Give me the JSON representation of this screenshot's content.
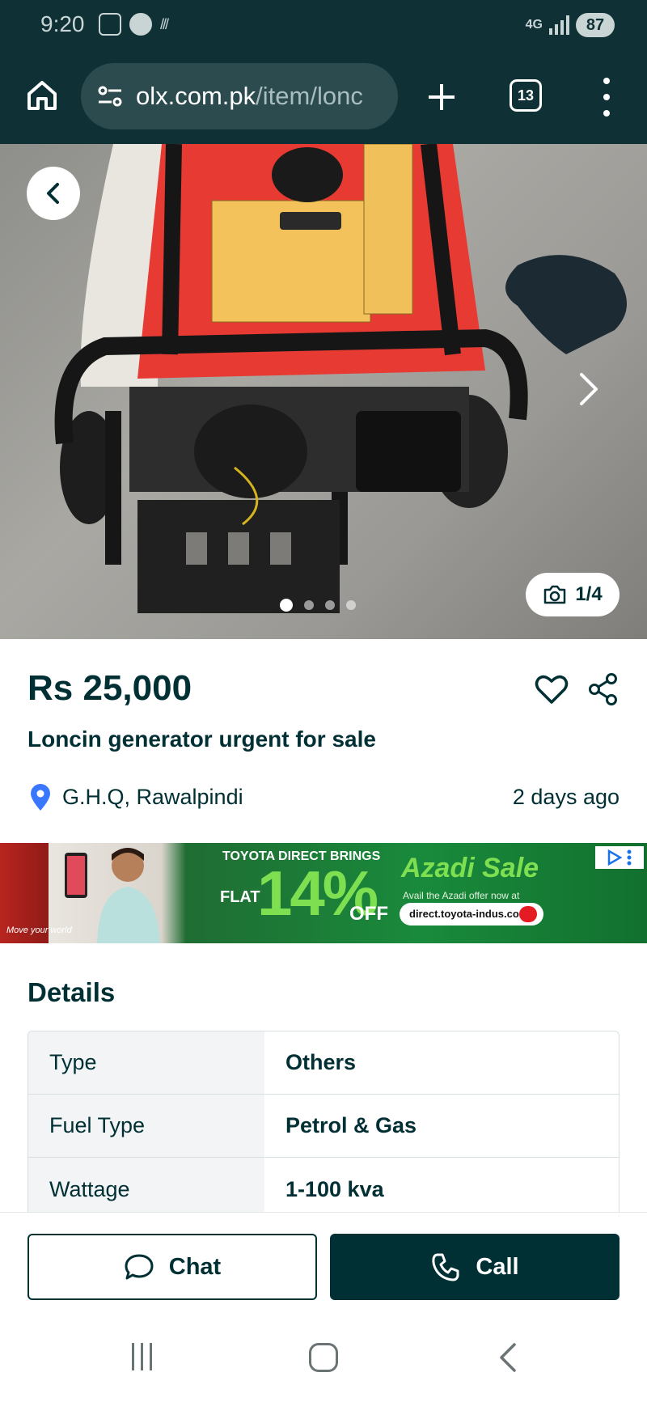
{
  "status_bar": {
    "time": "9:20",
    "network": "4G",
    "battery": "87"
  },
  "browser": {
    "url_domain": "olx.com.pk",
    "url_path": "/item/lonc",
    "tab_count": "13"
  },
  "gallery": {
    "counter": "1/4",
    "dot_count": 4,
    "active_index": 0
  },
  "listing": {
    "price": "Rs 25,000",
    "title": "Loncin generator urgent for sale",
    "location": "G.H.Q, Rawalpindi",
    "posted": "2 days ago"
  },
  "ad": {
    "headline": "TOYOTA DIRECT BRINGS",
    "flat": "FLAT",
    "percent": "14%",
    "off": "OFF",
    "sale_title": "Azadi Sale",
    "sub": "Avail the Azadi offer now at",
    "url": "direct.toyota-indus.com",
    "tagline": "Move your world"
  },
  "details": {
    "heading": "Details",
    "rows": [
      {
        "key": "Type",
        "value": "Others"
      },
      {
        "key": "Fuel Type",
        "value": "Petrol & Gas"
      },
      {
        "key": "Wattage",
        "value": "1-100 kva"
      }
    ]
  },
  "actions": {
    "chat_label": "Chat",
    "call_label": "Call"
  },
  "colors": {
    "brand_dark": "#002f34",
    "chrome_bg": "#0f3135",
    "location_pin": "#3a77ff",
    "ad_green": "#198a3b"
  }
}
